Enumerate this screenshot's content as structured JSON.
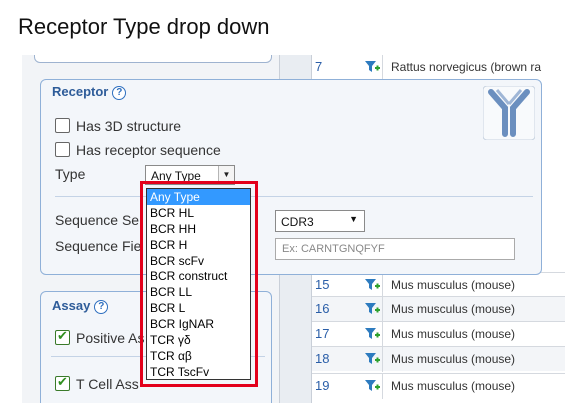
{
  "caption": "Receptor Type drop down",
  "receptor_panel": {
    "title": "Receptor",
    "has_3d_label": "Has 3D structure",
    "has_seq_label": "Has receptor sequence",
    "type_label": "Type",
    "type_value": "Any Type",
    "seq_search_label": "Sequence Se",
    "seq_field_label": "Sequence Fie",
    "cdr_value": "CDR3",
    "seq_placeholder": "Ex: CARNTGNQFYF"
  },
  "type_options": [
    "Any Type",
    "BCR HL",
    "BCR HH",
    "BCR H",
    "BCR scFv",
    "BCR construct",
    "BCR LL",
    "BCR L",
    "BCR IgNAR",
    "TCR γδ",
    "TCR αβ",
    "TCR TscFv"
  ],
  "assay_panel": {
    "title": "Assay",
    "positive_label": "Positive As",
    "tcell_label": "T Cell Ass"
  },
  "results": {
    "rows": [
      {
        "num": "7",
        "organism": "Rattus norvegicus (brown ra"
      },
      {
        "num": "15",
        "organism": "Mus musculus (mouse)"
      },
      {
        "num": "16",
        "organism": "Mus musculus (mouse)"
      },
      {
        "num": "17",
        "organism": "Mus musculus (mouse)"
      },
      {
        "num": "18",
        "organism": "Mus musculus (mouse)"
      },
      {
        "num": "19",
        "organism": "Mus musculus (mouse)"
      }
    ]
  },
  "colors": {
    "highlight": "#e3001b",
    "selected_option": "#3399ff",
    "panel_border": "#8fb0d8",
    "panel_title": "#2e5c99"
  }
}
